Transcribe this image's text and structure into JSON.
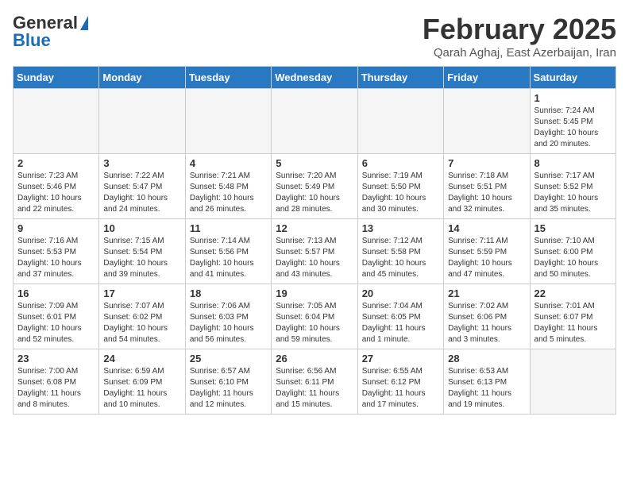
{
  "header": {
    "logo_general": "General",
    "logo_blue": "Blue",
    "month_title": "February 2025",
    "location": "Qarah Aghaj, East Azerbaijan, Iran"
  },
  "days_of_week": [
    "Sunday",
    "Monday",
    "Tuesday",
    "Wednesday",
    "Thursday",
    "Friday",
    "Saturday"
  ],
  "weeks": [
    [
      {
        "day": "",
        "empty": true
      },
      {
        "day": "",
        "empty": true
      },
      {
        "day": "",
        "empty": true
      },
      {
        "day": "",
        "empty": true
      },
      {
        "day": "",
        "empty": true
      },
      {
        "day": "",
        "empty": true
      },
      {
        "day": "1",
        "sunrise": "7:24 AM",
        "sunset": "5:45 PM",
        "daylight": "10 hours and 20 minutes."
      }
    ],
    [
      {
        "day": "2",
        "sunrise": "7:23 AM",
        "sunset": "5:46 PM",
        "daylight": "10 hours and 22 minutes."
      },
      {
        "day": "3",
        "sunrise": "7:22 AM",
        "sunset": "5:47 PM",
        "daylight": "10 hours and 24 minutes."
      },
      {
        "day": "4",
        "sunrise": "7:21 AM",
        "sunset": "5:48 PM",
        "daylight": "10 hours and 26 minutes."
      },
      {
        "day": "5",
        "sunrise": "7:20 AM",
        "sunset": "5:49 PM",
        "daylight": "10 hours and 28 minutes."
      },
      {
        "day": "6",
        "sunrise": "7:19 AM",
        "sunset": "5:50 PM",
        "daylight": "10 hours and 30 minutes."
      },
      {
        "day": "7",
        "sunrise": "7:18 AM",
        "sunset": "5:51 PM",
        "daylight": "10 hours and 32 minutes."
      },
      {
        "day": "8",
        "sunrise": "7:17 AM",
        "sunset": "5:52 PM",
        "daylight": "10 hours and 35 minutes."
      }
    ],
    [
      {
        "day": "9",
        "sunrise": "7:16 AM",
        "sunset": "5:53 PM",
        "daylight": "10 hours and 37 minutes."
      },
      {
        "day": "10",
        "sunrise": "7:15 AM",
        "sunset": "5:54 PM",
        "daylight": "10 hours and 39 minutes."
      },
      {
        "day": "11",
        "sunrise": "7:14 AM",
        "sunset": "5:56 PM",
        "daylight": "10 hours and 41 minutes."
      },
      {
        "day": "12",
        "sunrise": "7:13 AM",
        "sunset": "5:57 PM",
        "daylight": "10 hours and 43 minutes."
      },
      {
        "day": "13",
        "sunrise": "7:12 AM",
        "sunset": "5:58 PM",
        "daylight": "10 hours and 45 minutes."
      },
      {
        "day": "14",
        "sunrise": "7:11 AM",
        "sunset": "5:59 PM",
        "daylight": "10 hours and 47 minutes."
      },
      {
        "day": "15",
        "sunrise": "7:10 AM",
        "sunset": "6:00 PM",
        "daylight": "10 hours and 50 minutes."
      }
    ],
    [
      {
        "day": "16",
        "sunrise": "7:09 AM",
        "sunset": "6:01 PM",
        "daylight": "10 hours and 52 minutes."
      },
      {
        "day": "17",
        "sunrise": "7:07 AM",
        "sunset": "6:02 PM",
        "daylight": "10 hours and 54 minutes."
      },
      {
        "day": "18",
        "sunrise": "7:06 AM",
        "sunset": "6:03 PM",
        "daylight": "10 hours and 56 minutes."
      },
      {
        "day": "19",
        "sunrise": "7:05 AM",
        "sunset": "6:04 PM",
        "daylight": "10 hours and 59 minutes."
      },
      {
        "day": "20",
        "sunrise": "7:04 AM",
        "sunset": "6:05 PM",
        "daylight": "11 hours and 1 minute."
      },
      {
        "day": "21",
        "sunrise": "7:02 AM",
        "sunset": "6:06 PM",
        "daylight": "11 hours and 3 minutes."
      },
      {
        "day": "22",
        "sunrise": "7:01 AM",
        "sunset": "6:07 PM",
        "daylight": "11 hours and 5 minutes."
      }
    ],
    [
      {
        "day": "23",
        "sunrise": "7:00 AM",
        "sunset": "6:08 PM",
        "daylight": "11 hours and 8 minutes."
      },
      {
        "day": "24",
        "sunrise": "6:59 AM",
        "sunset": "6:09 PM",
        "daylight": "11 hours and 10 minutes."
      },
      {
        "day": "25",
        "sunrise": "6:57 AM",
        "sunset": "6:10 PM",
        "daylight": "11 hours and 12 minutes."
      },
      {
        "day": "26",
        "sunrise": "6:56 AM",
        "sunset": "6:11 PM",
        "daylight": "11 hours and 15 minutes."
      },
      {
        "day": "27",
        "sunrise": "6:55 AM",
        "sunset": "6:12 PM",
        "daylight": "11 hours and 17 minutes."
      },
      {
        "day": "28",
        "sunrise": "6:53 AM",
        "sunset": "6:13 PM",
        "daylight": "11 hours and 19 minutes."
      },
      {
        "day": "",
        "empty": true
      }
    ]
  ]
}
